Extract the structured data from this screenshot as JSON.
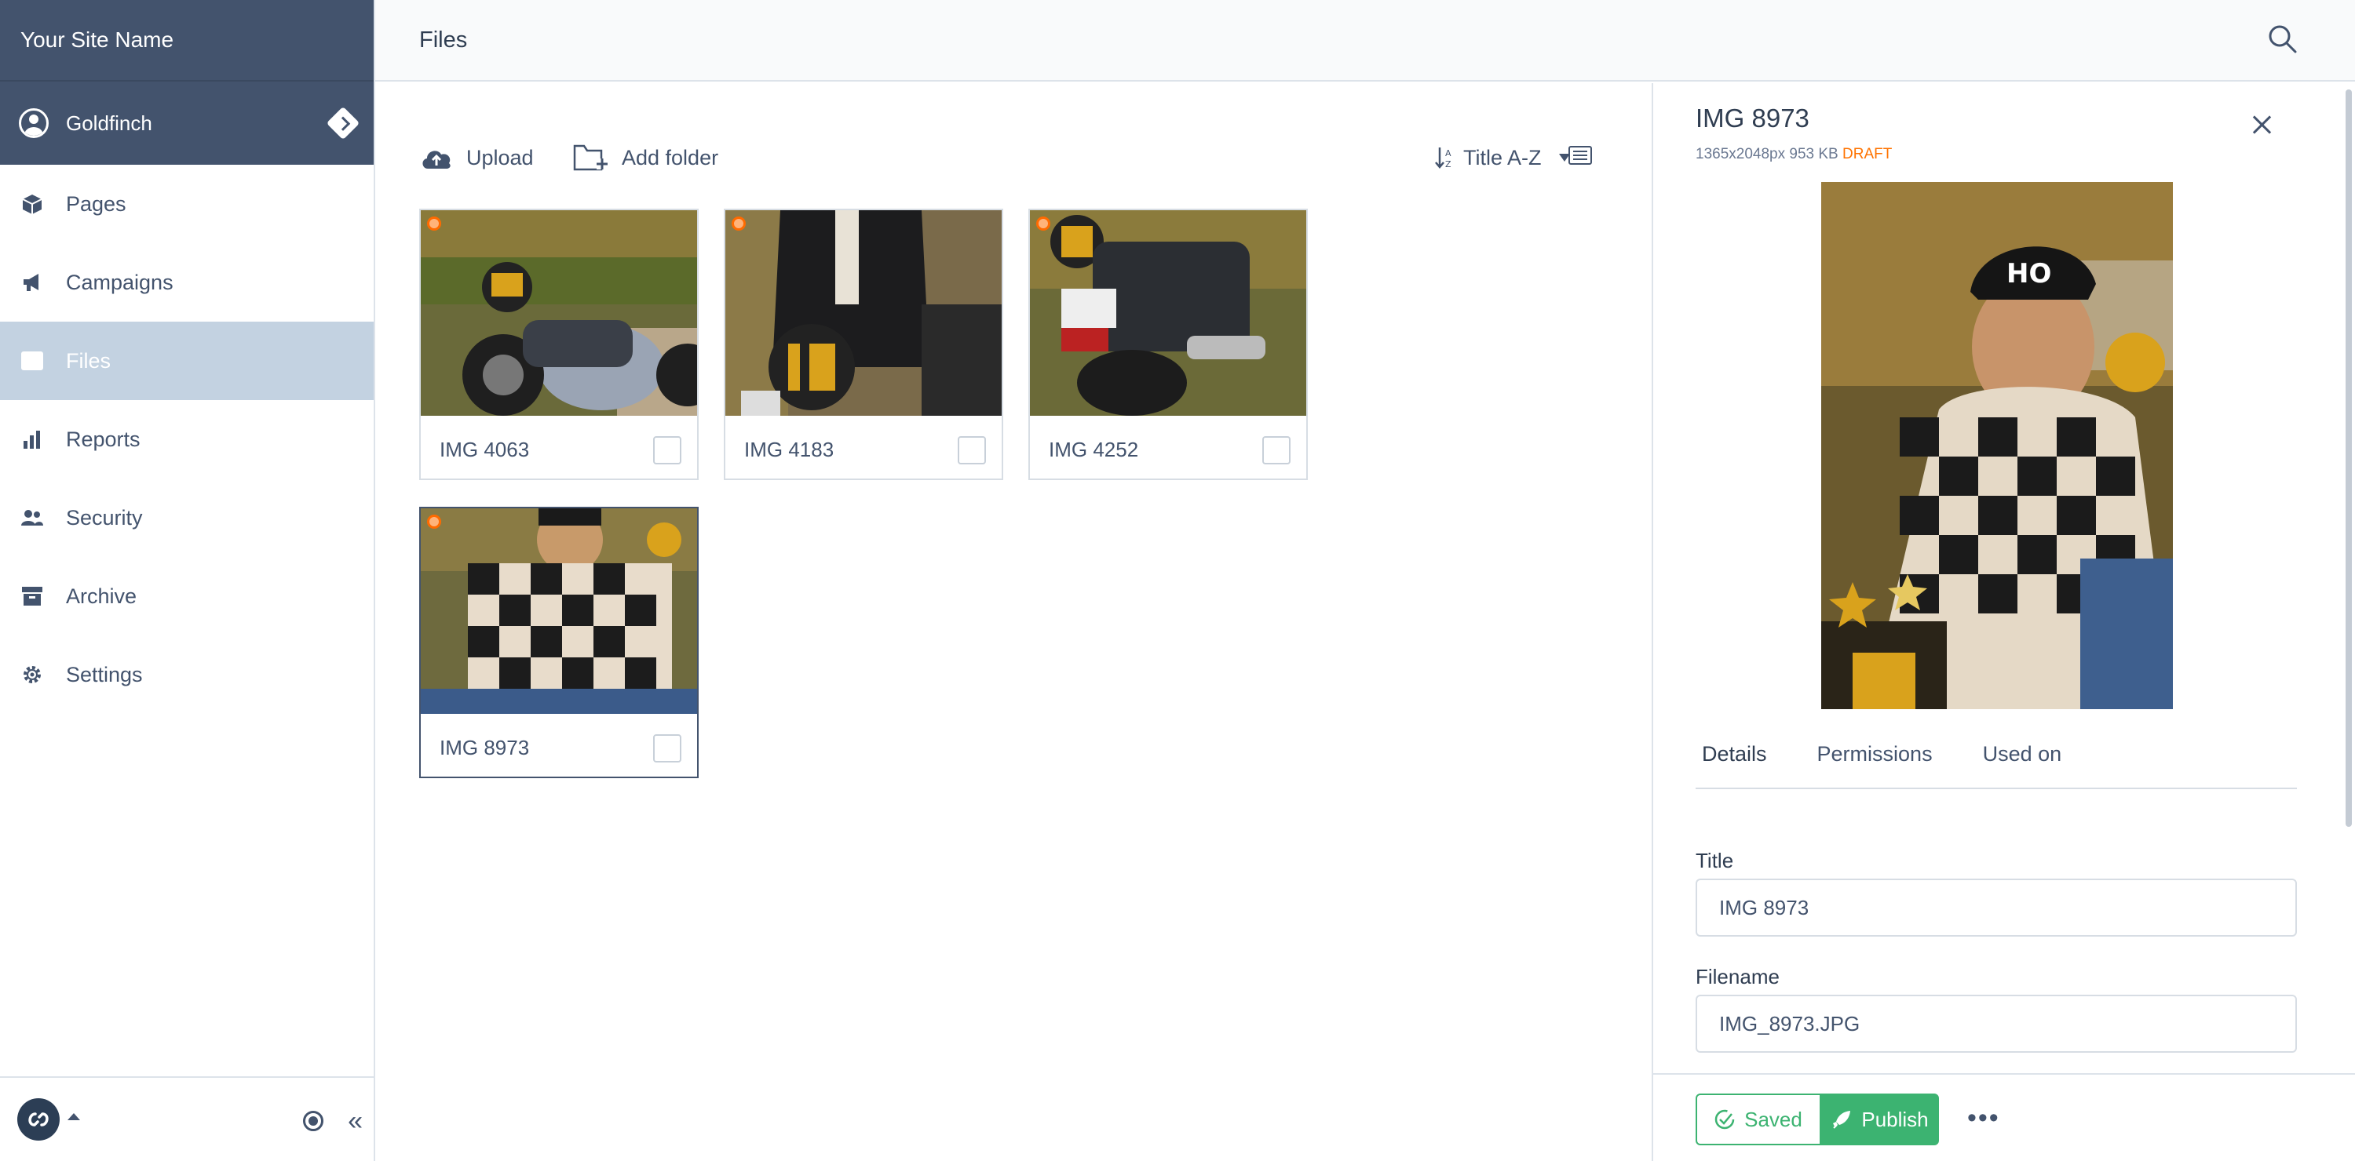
{
  "site": {
    "name": "Your Site Name"
  },
  "user": {
    "name": "Goldfinch"
  },
  "sidebar": {
    "items": [
      {
        "label": "Pages",
        "icon": "cube-icon"
      },
      {
        "label": "Campaigns",
        "icon": "megaphone-icon"
      },
      {
        "label": "Files",
        "icon": "image-icon",
        "active": true
      },
      {
        "label": "Reports",
        "icon": "bar-chart-icon"
      },
      {
        "label": "Security",
        "icon": "users-icon"
      },
      {
        "label": "Archive",
        "icon": "archive-box-icon"
      },
      {
        "label": "Settings",
        "icon": "gear-icon"
      }
    ],
    "collapse_label": "«"
  },
  "topbar": {
    "title": "Files"
  },
  "toolbar": {
    "upload_label": "Upload",
    "add_folder_label": "Add folder",
    "sort_label": "Title A-Z"
  },
  "files": [
    {
      "title": "IMG 4063"
    },
    {
      "title": "IMG 4183"
    },
    {
      "title": "IMG 4252"
    },
    {
      "title": "IMG 8973",
      "selected": true
    }
  ],
  "detail": {
    "title": "IMG 8973",
    "meta": "1365x2048px 953 KB",
    "status": "DRAFT",
    "tabs": [
      "Details",
      "Permissions",
      "Used on"
    ],
    "fields": {
      "title_label": "Title",
      "title_value": "IMG 8973",
      "filename_label": "Filename",
      "filename_value": "IMG_8973.JPG"
    },
    "actions": {
      "saved_label": "Saved",
      "publish_label": "Publish",
      "more_label": "•••"
    }
  },
  "colors": {
    "sidebar_header": "#43536d",
    "active_item": "#c3d2e1",
    "draft": "#ff7300",
    "success": "#3cb371"
  }
}
